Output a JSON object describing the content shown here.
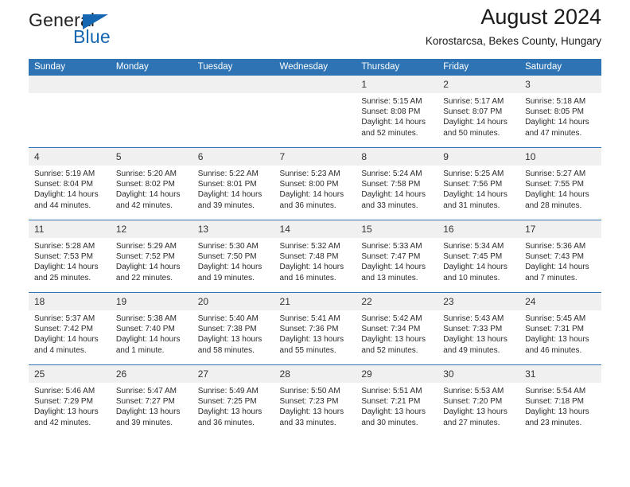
{
  "logo": {
    "word_one": "General",
    "word_two": "Blue",
    "triangle_color": "#1567b2",
    "text_color": "#222222"
  },
  "header": {
    "title": "August 2024",
    "subtitle": "Korostarcsa, Bekes County, Hungary"
  },
  "calendar": {
    "header_bg": "#2e74b5",
    "header_text_color": "#ffffff",
    "daynum_bg": "#f0f0f0",
    "weekdays": [
      "Sunday",
      "Monday",
      "Tuesday",
      "Wednesday",
      "Thursday",
      "Friday",
      "Saturday"
    ],
    "weeks": [
      [
        {
          "day": "",
          "sunrise": "",
          "sunset": "",
          "daylight": ""
        },
        {
          "day": "",
          "sunrise": "",
          "sunset": "",
          "daylight": ""
        },
        {
          "day": "",
          "sunrise": "",
          "sunset": "",
          "daylight": ""
        },
        {
          "day": "",
          "sunrise": "",
          "sunset": "",
          "daylight": ""
        },
        {
          "day": "1",
          "sunrise": "Sunrise: 5:15 AM",
          "sunset": "Sunset: 8:08 PM",
          "daylight": "Daylight: 14 hours and 52 minutes."
        },
        {
          "day": "2",
          "sunrise": "Sunrise: 5:17 AM",
          "sunset": "Sunset: 8:07 PM",
          "daylight": "Daylight: 14 hours and 50 minutes."
        },
        {
          "day": "3",
          "sunrise": "Sunrise: 5:18 AM",
          "sunset": "Sunset: 8:05 PM",
          "daylight": "Daylight: 14 hours and 47 minutes."
        }
      ],
      [
        {
          "day": "4",
          "sunrise": "Sunrise: 5:19 AM",
          "sunset": "Sunset: 8:04 PM",
          "daylight": "Daylight: 14 hours and 44 minutes."
        },
        {
          "day": "5",
          "sunrise": "Sunrise: 5:20 AM",
          "sunset": "Sunset: 8:02 PM",
          "daylight": "Daylight: 14 hours and 42 minutes."
        },
        {
          "day": "6",
          "sunrise": "Sunrise: 5:22 AM",
          "sunset": "Sunset: 8:01 PM",
          "daylight": "Daylight: 14 hours and 39 minutes."
        },
        {
          "day": "7",
          "sunrise": "Sunrise: 5:23 AM",
          "sunset": "Sunset: 8:00 PM",
          "daylight": "Daylight: 14 hours and 36 minutes."
        },
        {
          "day": "8",
          "sunrise": "Sunrise: 5:24 AM",
          "sunset": "Sunset: 7:58 PM",
          "daylight": "Daylight: 14 hours and 33 minutes."
        },
        {
          "day": "9",
          "sunrise": "Sunrise: 5:25 AM",
          "sunset": "Sunset: 7:56 PM",
          "daylight": "Daylight: 14 hours and 31 minutes."
        },
        {
          "day": "10",
          "sunrise": "Sunrise: 5:27 AM",
          "sunset": "Sunset: 7:55 PM",
          "daylight": "Daylight: 14 hours and 28 minutes."
        }
      ],
      [
        {
          "day": "11",
          "sunrise": "Sunrise: 5:28 AM",
          "sunset": "Sunset: 7:53 PM",
          "daylight": "Daylight: 14 hours and 25 minutes."
        },
        {
          "day": "12",
          "sunrise": "Sunrise: 5:29 AM",
          "sunset": "Sunset: 7:52 PM",
          "daylight": "Daylight: 14 hours and 22 minutes."
        },
        {
          "day": "13",
          "sunrise": "Sunrise: 5:30 AM",
          "sunset": "Sunset: 7:50 PM",
          "daylight": "Daylight: 14 hours and 19 minutes."
        },
        {
          "day": "14",
          "sunrise": "Sunrise: 5:32 AM",
          "sunset": "Sunset: 7:48 PM",
          "daylight": "Daylight: 14 hours and 16 minutes."
        },
        {
          "day": "15",
          "sunrise": "Sunrise: 5:33 AM",
          "sunset": "Sunset: 7:47 PM",
          "daylight": "Daylight: 14 hours and 13 minutes."
        },
        {
          "day": "16",
          "sunrise": "Sunrise: 5:34 AM",
          "sunset": "Sunset: 7:45 PM",
          "daylight": "Daylight: 14 hours and 10 minutes."
        },
        {
          "day": "17",
          "sunrise": "Sunrise: 5:36 AM",
          "sunset": "Sunset: 7:43 PM",
          "daylight": "Daylight: 14 hours and 7 minutes."
        }
      ],
      [
        {
          "day": "18",
          "sunrise": "Sunrise: 5:37 AM",
          "sunset": "Sunset: 7:42 PM",
          "daylight": "Daylight: 14 hours and 4 minutes."
        },
        {
          "day": "19",
          "sunrise": "Sunrise: 5:38 AM",
          "sunset": "Sunset: 7:40 PM",
          "daylight": "Daylight: 14 hours and 1 minute."
        },
        {
          "day": "20",
          "sunrise": "Sunrise: 5:40 AM",
          "sunset": "Sunset: 7:38 PM",
          "daylight": "Daylight: 13 hours and 58 minutes."
        },
        {
          "day": "21",
          "sunrise": "Sunrise: 5:41 AM",
          "sunset": "Sunset: 7:36 PM",
          "daylight": "Daylight: 13 hours and 55 minutes."
        },
        {
          "day": "22",
          "sunrise": "Sunrise: 5:42 AM",
          "sunset": "Sunset: 7:34 PM",
          "daylight": "Daylight: 13 hours and 52 minutes."
        },
        {
          "day": "23",
          "sunrise": "Sunrise: 5:43 AM",
          "sunset": "Sunset: 7:33 PM",
          "daylight": "Daylight: 13 hours and 49 minutes."
        },
        {
          "day": "24",
          "sunrise": "Sunrise: 5:45 AM",
          "sunset": "Sunset: 7:31 PM",
          "daylight": "Daylight: 13 hours and 46 minutes."
        }
      ],
      [
        {
          "day": "25",
          "sunrise": "Sunrise: 5:46 AM",
          "sunset": "Sunset: 7:29 PM",
          "daylight": "Daylight: 13 hours and 42 minutes."
        },
        {
          "day": "26",
          "sunrise": "Sunrise: 5:47 AM",
          "sunset": "Sunset: 7:27 PM",
          "daylight": "Daylight: 13 hours and 39 minutes."
        },
        {
          "day": "27",
          "sunrise": "Sunrise: 5:49 AM",
          "sunset": "Sunset: 7:25 PM",
          "daylight": "Daylight: 13 hours and 36 minutes."
        },
        {
          "day": "28",
          "sunrise": "Sunrise: 5:50 AM",
          "sunset": "Sunset: 7:23 PM",
          "daylight": "Daylight: 13 hours and 33 minutes."
        },
        {
          "day": "29",
          "sunrise": "Sunrise: 5:51 AM",
          "sunset": "Sunset: 7:21 PM",
          "daylight": "Daylight: 13 hours and 30 minutes."
        },
        {
          "day": "30",
          "sunrise": "Sunrise: 5:53 AM",
          "sunset": "Sunset: 7:20 PM",
          "daylight": "Daylight: 13 hours and 27 minutes."
        },
        {
          "day": "31",
          "sunrise": "Sunrise: 5:54 AM",
          "sunset": "Sunset: 7:18 PM",
          "daylight": "Daylight: 13 hours and 23 minutes."
        }
      ]
    ]
  }
}
